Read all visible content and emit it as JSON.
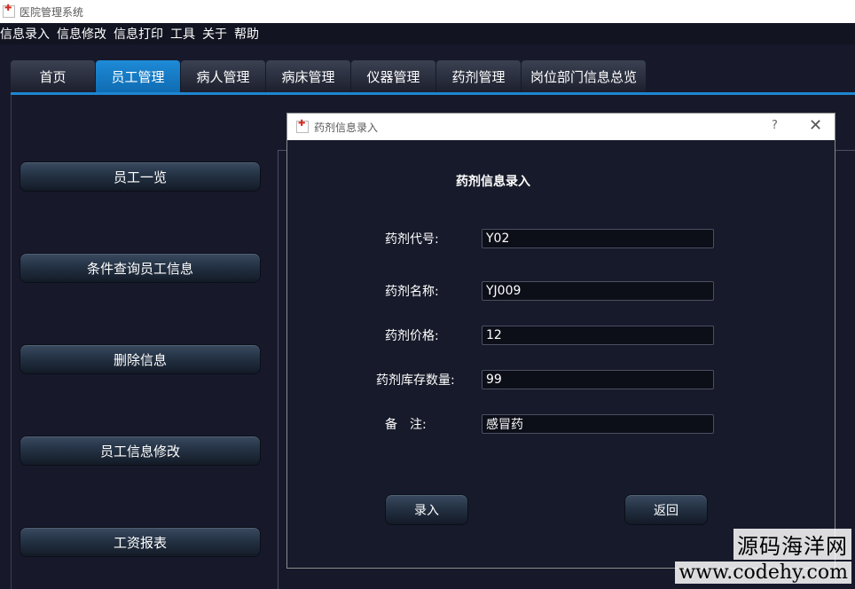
{
  "window": {
    "title": "医院管理系统"
  },
  "menu": [
    "信息录入",
    "信息修改",
    "信息打印",
    "工具",
    "关于",
    "帮助"
  ],
  "tabs": [
    {
      "label": "首页",
      "active": false
    },
    {
      "label": "员工管理",
      "active": true
    },
    {
      "label": "病人管理",
      "active": false
    },
    {
      "label": "病床管理",
      "active": false
    },
    {
      "label": "仪器管理",
      "active": false
    },
    {
      "label": "药剂管理",
      "active": false
    },
    {
      "label": "岗位部门信息总览",
      "active": false
    }
  ],
  "sidebar": [
    {
      "label": "员工一览"
    },
    {
      "label": "条件查询员工信息"
    },
    {
      "label": "删除信息"
    },
    {
      "label": "员工信息修改"
    },
    {
      "label": "工资报表"
    }
  ],
  "dialog": {
    "title": "药剂信息录入",
    "help": "?",
    "close": "✕",
    "heading": "药剂信息录入",
    "fields": [
      {
        "label": "药剂代号:",
        "value": "Y02"
      },
      {
        "label": "药剂名称:",
        "value": "YJ009"
      },
      {
        "label": "药剂价格:",
        "value": "12"
      },
      {
        "label": "药剂库存数量:",
        "value": "99"
      },
      {
        "label": "备　注:",
        "value": "感冒药"
      }
    ],
    "submit_label": "录入",
    "back_label": "返回"
  },
  "watermark": {
    "line1": "源码海洋网",
    "line2": "www.codehy.com"
  },
  "colors": {
    "accent": "#1d86d2",
    "background": "#17192b"
  }
}
